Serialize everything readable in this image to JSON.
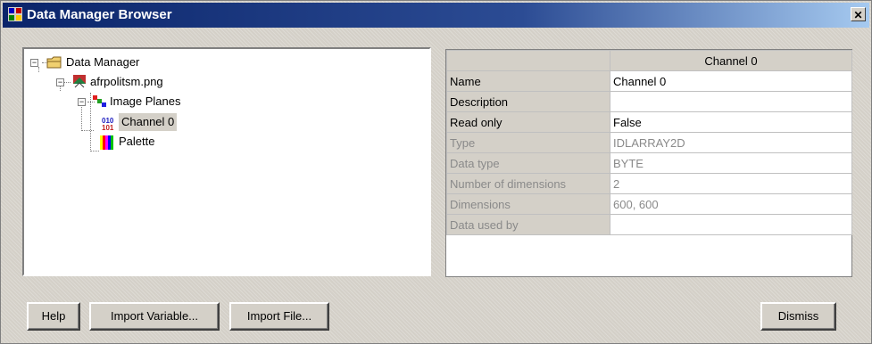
{
  "window": {
    "title": "Data Manager Browser",
    "close_glyph": "✕"
  },
  "tree": {
    "nodes": [
      {
        "label": "Data Manager",
        "icon": "folder-icon",
        "expander": "−"
      },
      {
        "label": "afrpolitsm.png",
        "icon": "image-file-icon",
        "expander": "−"
      },
      {
        "label": "Image Planes",
        "icon": "image-planes-icon",
        "expander": "−"
      },
      {
        "label": "Channel 0",
        "icon": "binary-data-icon",
        "selected": true
      },
      {
        "label": "Palette",
        "icon": "palette-icon"
      }
    ]
  },
  "properties": {
    "column_header": "Channel 0",
    "rows": [
      {
        "name": "Name",
        "value": "Channel 0",
        "enabled": true
      },
      {
        "name": "Description",
        "value": "",
        "enabled": true
      },
      {
        "name": "Read only",
        "value": "False",
        "enabled": true
      },
      {
        "name": "Type",
        "value": "IDLARRAY2D",
        "enabled": false
      },
      {
        "name": "Data type",
        "value": "BYTE",
        "enabled": false
      },
      {
        "name": "Number of dimensions",
        "value": "2",
        "enabled": false
      },
      {
        "name": "Dimensions",
        "value": "600, 600",
        "enabled": false
      },
      {
        "name": "Data used by",
        "value": "",
        "enabled": false
      }
    ]
  },
  "buttons": {
    "help": "Help",
    "import_variable": "Import Variable...",
    "import_file": "Import File...",
    "dismiss": "Dismiss"
  },
  "colors": {
    "title_bar_start": "#0a246a",
    "title_bar_end": "#a6caf0",
    "dialog_face": "#d4d0c8",
    "disabled_text": "#8a8a8a"
  }
}
